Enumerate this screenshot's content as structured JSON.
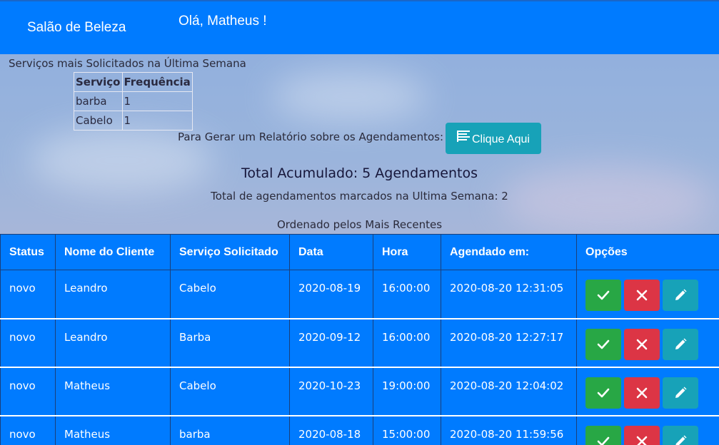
{
  "header": {
    "brand": "Salão de Beleza",
    "greeting": "Olá, Matheus !"
  },
  "top_services": {
    "title": "Serviços mais Solicitados na Última Semana",
    "columns": [
      "Serviço",
      "Frequência"
    ],
    "rows": [
      [
        "barba",
        "1"
      ],
      [
        "Cabelo",
        "1"
      ]
    ]
  },
  "report": {
    "text": "Para Gerar um Relatório sobre os Agendamentos:",
    "button_label": "Clique Aqui",
    "button_icon": "list-icon"
  },
  "totals": {
    "title": "Total Acumulado: 5 Agendamentos",
    "week": "Total de agendamentos marcados na Ultima Semana: 2"
  },
  "schedule": {
    "caption": "Ordenado pelos Mais Recentes",
    "columns": [
      "Status",
      "Nome do Cliente",
      "Serviço Solicitado",
      "Data",
      "Hora",
      "Agendado em:",
      "Opções"
    ],
    "rows": [
      [
        "novo",
        "Leandro",
        "Cabelo",
        "2020-08-19",
        "16:00:00",
        "2020-08-20 12:31:05"
      ],
      [
        "novo",
        "Leandro",
        "Barba",
        "2020-09-12",
        "16:00:00",
        "2020-08-20 12:27:17"
      ],
      [
        "novo",
        "Matheus",
        "Cabelo",
        "2020-10-23",
        "19:00:00",
        "2020-08-20 12:04:02"
      ],
      [
        "novo",
        "Matheus",
        "barba",
        "2020-08-18",
        "15:00:00",
        "2020-08-20 11:59:56"
      ]
    ],
    "option_icons": [
      "check-icon",
      "close-icon",
      "pencil-icon"
    ]
  },
  "colors": {
    "primary": "#007bff",
    "success": "#28a745",
    "danger": "#dc3545",
    "info": "#17a2b8"
  }
}
